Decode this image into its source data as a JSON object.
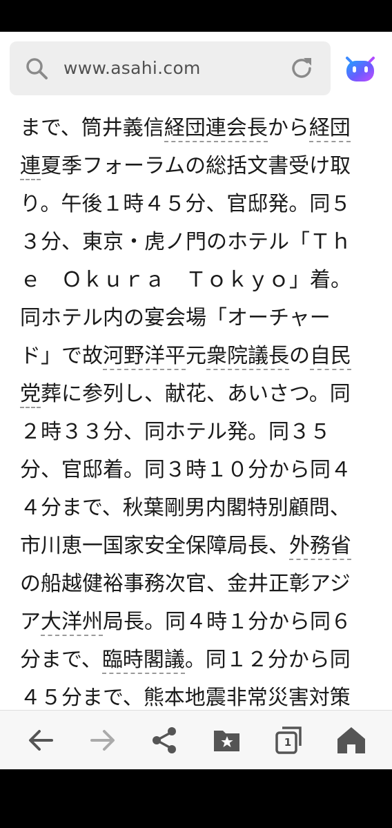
{
  "browser": {
    "url": "www.asahi.com",
    "search_icon": "search-icon",
    "reload_icon": "reload-icon",
    "assistant_icon": "assistant-bot-icon"
  },
  "article": {
    "segments": [
      "まで、筒井義信",
      "経団連会長",
      "から",
      "経団",
      "連",
      "夏季フォーラムの総括文書受け取",
      "り。午後１時４５分、官邸発。同５",
      "３分、東京・虎ノ門のホテル「Ｔｈ",
      "ｅ　Ｏｋｕｒａ　Ｔｏｋｙｏ」着。",
      "同ホテル内の宴会場「オーチャー",
      "ド」で故",
      "河野洋平",
      "元",
      "衆院議長",
      "の",
      "自民",
      "党",
      "葬に参列し、献花、あいさつ。同",
      "２時３３分、同ホテル発。同３５",
      "分、官邸着。同３時１０分から同４",
      "４分まで、秋葉剛男内閣特別顧問、",
      "市川恵一国家安全保障局長、",
      "外務省",
      "の船越健裕事務次官、金井正彰アジ",
      "ア",
      "大洋州",
      "局長。同４時１分から同６",
      "分まで、",
      "臨時閣議",
      "。同１２分から同",
      "４５分まで、",
      "熊本地震",
      "非常",
      "災害対策"
    ]
  },
  "toolbar": {
    "back_icon": "back-arrow-icon",
    "forward_icon": "forward-arrow-icon",
    "share_icon": "share-icon",
    "bookmarks_icon": "bookmark-folder-icon",
    "tabs_count": "1",
    "home_icon": "home-icon"
  },
  "colors": {
    "enabled_icon": "#555555",
    "disabled_icon": "#aaaaaa",
    "link_underline": "#9a9a9a"
  }
}
